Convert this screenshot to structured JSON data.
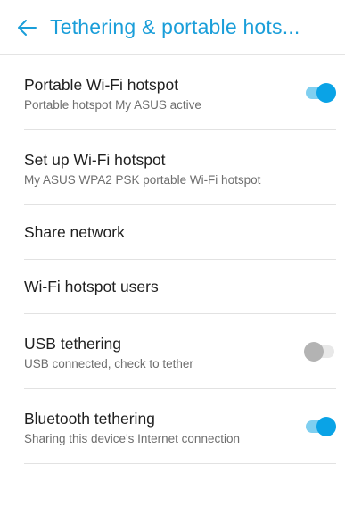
{
  "header": {
    "back_icon": "arrow-left-icon",
    "title": "Tethering & portable hots..."
  },
  "items": [
    {
      "title": "Portable Wi-Fi hotspot",
      "subtitle": "Portable hotspot My ASUS active",
      "toggle": "on"
    },
    {
      "title": "Set up Wi-Fi hotspot",
      "subtitle": "My ASUS WPA2 PSK portable Wi-Fi hotspot"
    },
    {
      "title": "Share network"
    },
    {
      "title": "Wi-Fi hotspot users"
    },
    {
      "title": "USB tethering",
      "subtitle": "USB connected, check to tether",
      "toggle": "off"
    },
    {
      "title": "Bluetooth tethering",
      "subtitle": "Sharing this device's Internet connection",
      "toggle": "on"
    }
  ],
  "colors": {
    "accent": "#1a9ed9",
    "toggle_on_thumb": "#0aa3e6",
    "toggle_on_track": "#7fcff0",
    "toggle_off_thumb": "#b3b3b3",
    "toggle_off_track": "#e8e8e8"
  }
}
